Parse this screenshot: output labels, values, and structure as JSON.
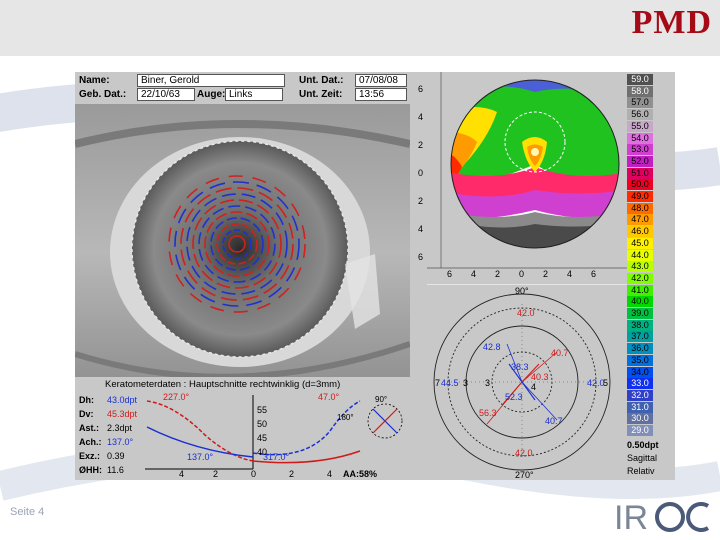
{
  "slide": {
    "brand": "PMD",
    "page": "Seite 4",
    "logo": "IROC",
    "accent": "#a50a16"
  },
  "patient": {
    "name_label": "Name:",
    "name_value": "Biner, Gerold",
    "dob_label": "Geb. Dat.:",
    "dob_value": "22/10/63",
    "eye_label": "Auge:",
    "eye_value": "Links",
    "exam_date_label": "Unt. Dat.:",
    "exam_date_value": "07/08/08",
    "exam_time_label": "Unt. Zeit:",
    "exam_time_value": "13:56"
  },
  "kerato": {
    "title": "Keratometerdaten : Hauptschnitte rechtwinklig (d=3mm)",
    "rows": [
      {
        "label": "Dh:",
        "value": "43.0dpt",
        "color": "#1a2fd0"
      },
      {
        "label": "Dv:",
        "value": "45.3dpt",
        "color": "#d01a1a"
      },
      {
        "label": "Ast.:",
        "value": "2.3dpt",
        "color": "#000000"
      },
      {
        "label": "Ach.:",
        "value": "137.0°",
        "color": "#1a2fd0"
      },
      {
        "label": "Exz.:",
        "value": "0.39",
        "color": "#000000"
      },
      {
        "label": "ØHH:",
        "value": "11.6",
        "color": "#000000"
      }
    ],
    "angles": {
      "a1": "227.0°",
      "a2": "47.0°",
      "a3": "137.0°",
      "a4": "317.0°"
    },
    "yticks": [
      "55",
      "50",
      "45",
      "40"
    ],
    "xticks": [
      "4",
      "2",
      "0",
      "2",
      "4"
    ],
    "aa": "AA:58%",
    "mini_labels": {
      "top": "90°",
      "left": "180°"
    }
  },
  "topo": {
    "left_ticks": [
      "6",
      "4",
      "2",
      "0",
      "2",
      "4",
      "6"
    ],
    "bottom_ticks": [
      "6",
      "4",
      "2",
      "0",
      "2",
      "4",
      "6"
    ]
  },
  "polar": {
    "top_label": "90°",
    "bottom_label": "270°",
    "left_label": "7",
    "right_label": "5",
    "values": {
      "r1": "42.0",
      "r2": "42.8",
      "r3": "40.7",
      "r4": "38.3",
      "r5": "40.3",
      "r6": "52.3",
      "r7": "56.3",
      "r8": "44.5",
      "r9": "42.0",
      "r10": "40.7",
      "r11": "42.0",
      "r12": "40.7",
      "r13": "40.7",
      "c1": "3",
      "c2": "3",
      "c3": "4"
    }
  },
  "scale": {
    "values": [
      "59.0",
      "58.0",
      "57.0",
      "56.0",
      "55.0",
      "54.0",
      "53.0",
      "52.0",
      "51.0",
      "50.0",
      "49.0",
      "48.0",
      "47.0",
      "46.0",
      "45.0",
      "44.0",
      "43.0",
      "42.0",
      "41.0",
      "40.0",
      "39.0",
      "38.0",
      "37.0",
      "36.0",
      "35.0",
      "34.0",
      "33.0",
      "32.0",
      "31.0",
      "30.0",
      "29.0"
    ],
    "colors": [
      "#505050",
      "#707070",
      "#909090",
      "#b0b0b0",
      "#c8a8c8",
      "#e070e0",
      "#d040d0",
      "#c020c0",
      "#e00060",
      "#f00020",
      "#ff2a00",
      "#ff6a00",
      "#ff9a00",
      "#ffc800",
      "#fff000",
      "#e8ff00",
      "#b8ff00",
      "#80ff00",
      "#40f000",
      "#00d800",
      "#00c040",
      "#00b080",
      "#00a0a0",
      "#0090c0",
      "#0070e0",
      "#0050f0",
      "#1030f0",
      "#3040c8",
      "#4060b0",
      "#6070a0",
      "#8090b8"
    ],
    "foot1": "0.50dpt",
    "foot2": "Sagittal",
    "foot3": "Relativ"
  }
}
